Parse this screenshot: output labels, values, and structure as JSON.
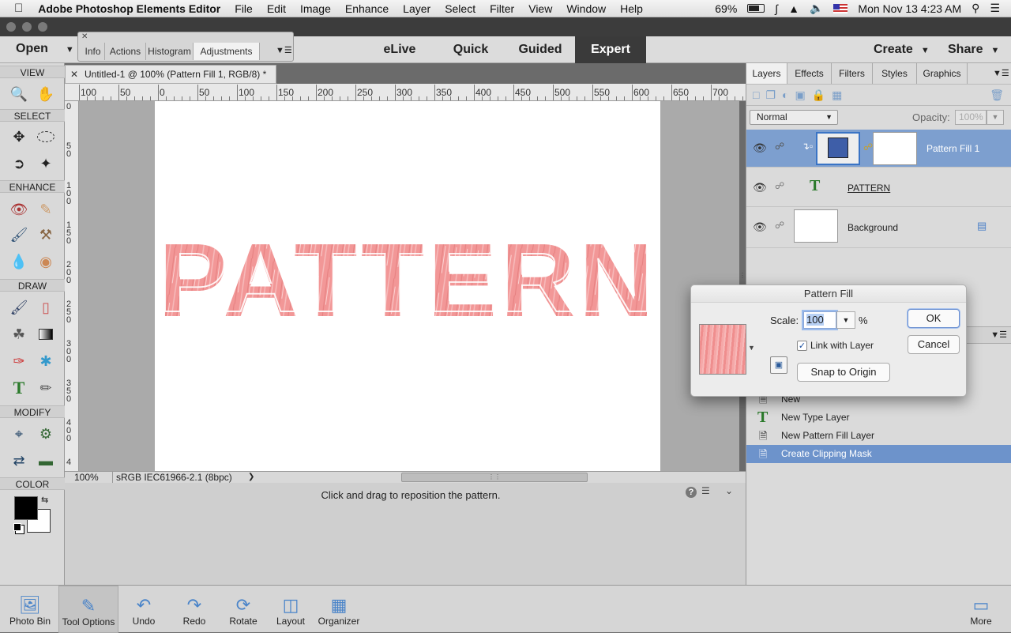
{
  "menubar": {
    "apple": "",
    "app_name": "Adobe Photoshop Elements Editor",
    "items": [
      "File",
      "Edit",
      "Image",
      "Enhance",
      "Layer",
      "Select",
      "Filter",
      "View",
      "Window",
      "Help"
    ],
    "battery": "69%",
    "datetime": "Mon Nov 13  4:23 AM"
  },
  "topbar": {
    "open_label": "Open",
    "modes": [
      "eLive",
      "Quick",
      "Guided",
      "Expert"
    ],
    "active_mode": "Expert",
    "create_label": "Create",
    "share_label": "Share"
  },
  "float_panel": {
    "tabs": [
      "Info",
      "Actions",
      "Histogram",
      "Adjustments"
    ],
    "active_tab": "Adjustments"
  },
  "toolbox": {
    "sections": [
      "VIEW",
      "SELECT",
      "ENHANCE",
      "DRAW",
      "MODIFY",
      "COLOR"
    ],
    "foreground_color": "#000000",
    "background_color": "#ffffff"
  },
  "document": {
    "tab_title": "Untitled-1 @ 100% (Pattern Fill 1, RGB/8) *",
    "canvas_text": "PATTERN",
    "text_color": "#f28b8b",
    "zoom": "100%",
    "profile": "sRGB IEC61966-2.1 (8bpc)",
    "hint": "Click and drag to reposition the pattern.",
    "ruler_top": [
      "100",
      "50",
      "0",
      "50",
      "100",
      "150",
      "200",
      "250",
      "300",
      "350",
      "400",
      "450",
      "500",
      "550",
      "600",
      "650",
      "700"
    ],
    "ruler_left": [
      "0",
      "50",
      "100",
      "150",
      "200",
      "250",
      "300",
      "350",
      "400",
      "4"
    ]
  },
  "right_panel": {
    "tabs": [
      "Layers",
      "Effects",
      "Filters",
      "Styles",
      "Graphics"
    ],
    "active_tab": "Layers",
    "blend_mode": "Normal",
    "opacity_label": "Opacity:",
    "opacity_value": "100%",
    "layers": [
      {
        "name": "Pattern Fill 1",
        "selected": true
      },
      {
        "name": "PATTERN",
        "selected": false
      },
      {
        "name": "Background",
        "selected": false
      }
    ],
    "history": [
      {
        "label": "New",
        "selected": false
      },
      {
        "label": "New Type Layer",
        "selected": false
      },
      {
        "label": "New Pattern Fill Layer",
        "selected": false
      },
      {
        "label": "Create Clipping Mask",
        "selected": true
      }
    ]
  },
  "dialog": {
    "title": "Pattern Fill",
    "scale_label": "Scale:",
    "scale_value": "100",
    "scale_unit": "%",
    "link_label": "Link with Layer",
    "link_checked": true,
    "snap_label": "Snap to Origin",
    "ok_label": "OK",
    "cancel_label": "Cancel"
  },
  "bottombar": {
    "items": [
      "Photo Bin",
      "Tool Options",
      "Undo",
      "Redo",
      "Rotate",
      "Layout",
      "Organizer"
    ],
    "more_label": "More"
  }
}
